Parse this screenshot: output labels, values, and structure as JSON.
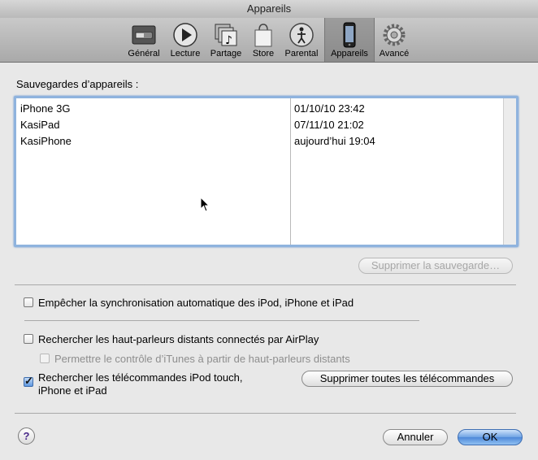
{
  "window": {
    "title": "Appareils"
  },
  "toolbar": {
    "items": [
      {
        "label": "Général",
        "icon": "general-switch-icon",
        "active": false
      },
      {
        "label": "Lecture",
        "icon": "play-icon",
        "active": false
      },
      {
        "label": "Partage",
        "icon": "sharing-music-icon",
        "active": false
      },
      {
        "label": "Store",
        "icon": "shopping-bag-icon",
        "active": false
      },
      {
        "label": "Parental",
        "icon": "parental-figure-icon",
        "active": false
      },
      {
        "label": "Appareils",
        "icon": "iphone-icon",
        "active": true
      },
      {
        "label": "Avancé",
        "icon": "gear-icon",
        "active": false
      }
    ]
  },
  "backups": {
    "label": "Sauvegardes d’appareils :",
    "rows": [
      {
        "name": "iPhone 3G",
        "date": "01/10/10 23:42"
      },
      {
        "name": "KasiPad",
        "date": "07/11/10 21:02"
      },
      {
        "name": "KasiPhone",
        "date": "aujourd’hui 19:04"
      }
    ],
    "delete_button": "Supprimer la sauvegarde…"
  },
  "options": {
    "prevent_sync": {
      "label": "Empêcher la synchronisation automatique des iPod, iPhone et iPad",
      "checked": false
    },
    "airplay_search": {
      "label": "Rechercher les haut-parleurs distants connectés par AirPlay",
      "checked": false
    },
    "itunes_control": {
      "label": "Permettre le contrôle d’iTunes à partir de haut-parleurs distants",
      "checked": false,
      "disabled": true
    },
    "remotes_search": {
      "label_line1": "Rechercher les télécommandes iPod touch,",
      "label_line2": "iPhone et iPad",
      "checked": true
    },
    "remove_remotes_button": "Supprimer toutes les télécommandes"
  },
  "footer": {
    "help": "?",
    "cancel": "Annuler",
    "ok": "OK"
  },
  "colors": {
    "accent": "#5f90cc",
    "default_button": "#4e88d8"
  }
}
